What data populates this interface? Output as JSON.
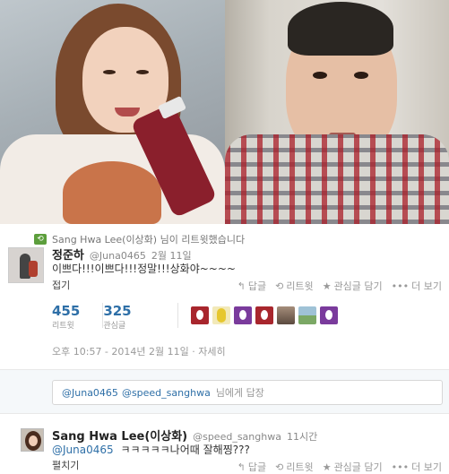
{
  "retweet_banner": {
    "text": "Sang Hwa Lee(이상화) 님이 리트윗했습니다"
  },
  "tweet": {
    "name": "정준하",
    "handle": "@Juna0465",
    "date": "2월 11일",
    "text": "이쁘다!!!이쁘다!!!정말!!!상화야~~~~",
    "collapse": "접기",
    "actions": {
      "reply": "답글",
      "retweet": "리트윗",
      "favorite": "관심글 담기",
      "more": "더 보기"
    },
    "stats": {
      "retweets_count": "455",
      "retweets_label": "리트윗",
      "favorites_count": "325",
      "favorites_label": "관심글"
    },
    "timestamp": "오후 10:57 - 2014년 2월 11일",
    "detail_link": "자세히"
  },
  "reply_box": {
    "mention1": "@Juna0465",
    "mention2": "@speed_sanghwa",
    "suffix": "님에게 답장"
  },
  "reply": {
    "name": "Sang Hwa Lee(이상화)",
    "handle": "@speed_sanghwa",
    "time": "11시간",
    "mention": "@Juna0465",
    "text": "ㅋㅋㅋㅋㅋ나어때 잘해찡???",
    "expand": "펼치기",
    "actions": {
      "reply": "답글",
      "retweet": "리트윗",
      "favorite": "관심글 담기",
      "more": "더 보기"
    }
  },
  "colors": {
    "link": "#2e6fa7",
    "muted": "#999999",
    "retweet_icon": "#5c9e3c"
  },
  "icons": [
    "retweet-icon",
    "reply-icon",
    "star-icon",
    "more-dots-icon"
  ]
}
